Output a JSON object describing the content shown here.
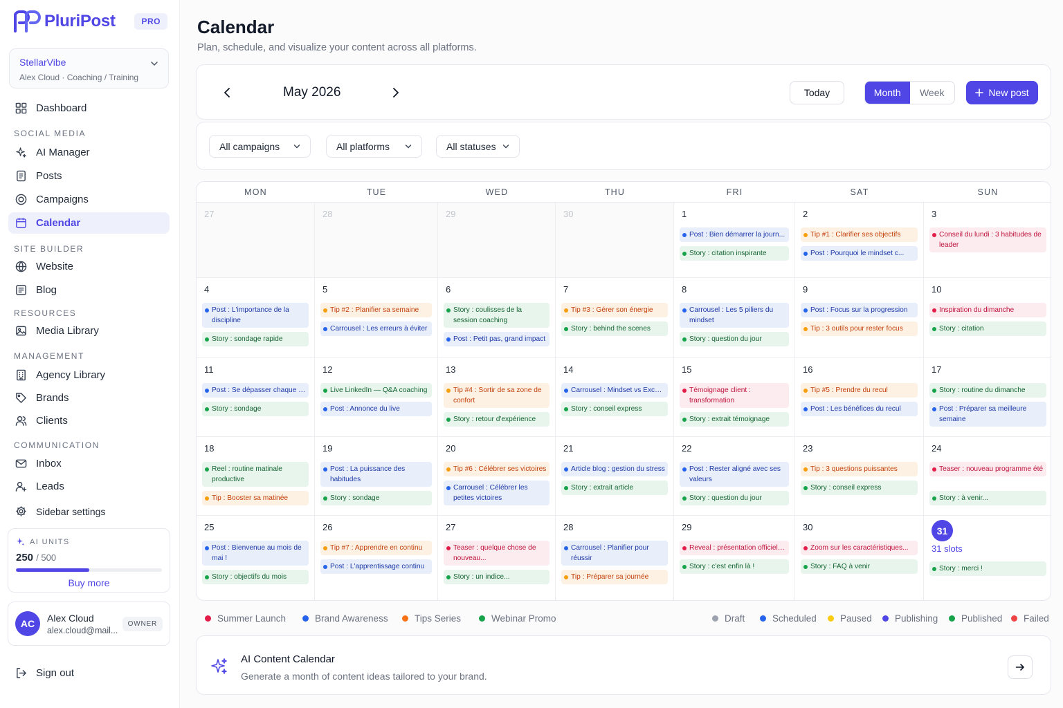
{
  "brand": {
    "name": "PluriPost",
    "badge": "PRO",
    "accent": "#4f46e5"
  },
  "workspace": {
    "name": "StellarVibe",
    "subtitle": "Alex Cloud · Coaching / Training"
  },
  "nav": {
    "dashboard": "Dashboard",
    "social_section": "SOCIAL MEDIA",
    "ai_manager": "AI Manager",
    "posts": "Posts",
    "campaigns": "Campaigns",
    "calendar": "Calendar",
    "site_section": "SITE BUILDER",
    "website": "Website",
    "blog": "Blog",
    "resources_section": "RESOURCES",
    "media_library": "Media Library",
    "management_section": "MANAGEMENT",
    "agency_library": "Agency Library",
    "brands": "Brands",
    "clients": "Clients",
    "communication_section": "COMMUNICATION",
    "inbox": "Inbox",
    "leads": "Leads",
    "sidebar_settings": "Sidebar settings",
    "sign_out": "Sign out"
  },
  "ai_units": {
    "label": "AI UNITS",
    "used": "250",
    "max": "/ 500",
    "fraction": 0.5,
    "buy_more": "Buy more"
  },
  "user": {
    "initials": "AC",
    "name": "Alex Cloud",
    "email": "alex.cloud@mail...",
    "role": "OWNER"
  },
  "header": {
    "title": "Calendar",
    "subtitle": "Plan, schedule, and visualize your content across all platforms."
  },
  "toolbar": {
    "month": "May 2026",
    "today": "Today",
    "view_month": "Month",
    "view_week": "Week",
    "new_post": "New post"
  },
  "filters": {
    "campaigns": "All campaigns",
    "platforms": "All platforms",
    "statuses": "All statuses"
  },
  "weekdays": [
    "MON",
    "TUE",
    "WED",
    "THU",
    "FRI",
    "SAT",
    "SUN"
  ],
  "weeks": [
    [
      {
        "day": "27",
        "muted": true,
        "events": []
      },
      {
        "day": "28",
        "muted": true,
        "events": []
      },
      {
        "day": "29",
        "muted": true,
        "events": []
      },
      {
        "day": "30",
        "muted": true,
        "events": []
      },
      {
        "day": "1",
        "events": [
          {
            "text": "Post : Bien démarrer la journ...",
            "color": "blue"
          },
          {
            "text": "Story : citation inspirante",
            "color": "green"
          }
        ]
      },
      {
        "day": "2",
        "events": [
          {
            "text": "Tip #1 : Clarifier ses objectifs",
            "color": "orange"
          },
          {
            "text": "Post : Pourquoi le mindset c...",
            "color": "blue"
          }
        ]
      },
      {
        "day": "3",
        "events": [
          {
            "text": "Conseil du lundi : 3 habitudes de leader",
            "color": "pink",
            "wrap": true
          }
        ]
      }
    ],
    [
      {
        "day": "4",
        "events": [
          {
            "text": "Post : L'importance de la discipline",
            "color": "blue",
            "wrap": true
          },
          {
            "text": "Story : sondage rapide",
            "color": "green"
          }
        ]
      },
      {
        "day": "5",
        "events": [
          {
            "text": "Tip #2 : Planifier sa semaine",
            "color": "orange"
          },
          {
            "text": "Carrousel : Les erreurs à éviter",
            "color": "blue"
          }
        ]
      },
      {
        "day": "6",
        "events": [
          {
            "text": "Story : coulisses de la session coaching",
            "color": "green",
            "wrap": true
          },
          {
            "text": "Post : Petit pas, grand impact",
            "color": "blue"
          }
        ]
      },
      {
        "day": "7",
        "events": [
          {
            "text": "Tip #3 : Gérer son énergie",
            "color": "orange"
          },
          {
            "text": "Story : behind the scenes",
            "color": "green"
          }
        ]
      },
      {
        "day": "8",
        "events": [
          {
            "text": "Carrousel : Les 5 piliers du mindset",
            "color": "blue",
            "wrap": true
          },
          {
            "text": "Story : question du jour",
            "color": "green"
          }
        ]
      },
      {
        "day": "9",
        "events": [
          {
            "text": "Post : Focus sur la progression",
            "color": "blue"
          },
          {
            "text": "Tip : 3 outils pour rester focus",
            "color": "orange"
          }
        ]
      },
      {
        "day": "10",
        "events": [
          {
            "text": "Inspiration du dimanche",
            "color": "pink"
          },
          {
            "text": "Story : citation",
            "color": "green"
          }
        ]
      }
    ],
    [
      {
        "day": "11",
        "events": [
          {
            "text": "Post : Se dépasser chaque jour",
            "color": "blue"
          },
          {
            "text": "Story : sondage",
            "color": "green"
          }
        ]
      },
      {
        "day": "12",
        "events": [
          {
            "text": "Live LinkedIn — Q&A coaching",
            "color": "green"
          },
          {
            "text": "Post : Annonce du live",
            "color": "blue"
          }
        ]
      },
      {
        "day": "13",
        "events": [
          {
            "text": "Tip #4 : Sortir de sa zone de confort",
            "color": "orange",
            "wrap": true
          },
          {
            "text": "Story : retour d'expérience",
            "color": "green"
          }
        ]
      },
      {
        "day": "14",
        "events": [
          {
            "text": "Carrousel : Mindset vs Excuses",
            "color": "blue"
          },
          {
            "text": "Story : conseil express",
            "color": "green"
          }
        ]
      },
      {
        "day": "15",
        "events": [
          {
            "text": "Témoignage client : transformation",
            "color": "pink",
            "wrap": true
          },
          {
            "text": "Story : extrait témoignage",
            "color": "green"
          }
        ]
      },
      {
        "day": "16",
        "events": [
          {
            "text": "Tip #5 : Prendre du recul",
            "color": "orange"
          },
          {
            "text": "Post : Les bénéfices du recul",
            "color": "blue"
          }
        ]
      },
      {
        "day": "17",
        "events": [
          {
            "text": "Story : routine du dimanche",
            "color": "green"
          },
          {
            "text": "Post : Préparer sa meilleure semaine",
            "color": "blue",
            "wrap": true
          }
        ]
      }
    ],
    [
      {
        "day": "18",
        "events": [
          {
            "text": "Reel : routine matinale productive",
            "color": "green",
            "wrap": true
          },
          {
            "text": "Tip : Booster sa matinée",
            "color": "orange"
          }
        ]
      },
      {
        "day": "19",
        "events": [
          {
            "text": "Post : La puissance des habitudes",
            "color": "blue",
            "wrap": true
          },
          {
            "text": "Story : sondage",
            "color": "green"
          }
        ]
      },
      {
        "day": "20",
        "events": [
          {
            "text": "Tip #6 : Célébrer ses victoires",
            "color": "orange"
          },
          {
            "text": "Carrousel : Célébrer les petites victoires",
            "color": "blue",
            "wrap": true
          }
        ]
      },
      {
        "day": "21",
        "events": [
          {
            "text": "Article blog : gestion du stress",
            "color": "blue"
          },
          {
            "text": "Story : extrait article",
            "color": "green"
          }
        ]
      },
      {
        "day": "22",
        "events": [
          {
            "text": "Post : Rester aligné avec ses valeurs",
            "color": "blue",
            "wrap": true
          },
          {
            "text": "Story : question du jour",
            "color": "green"
          }
        ]
      },
      {
        "day": "23",
        "events": [
          {
            "text": "Tip : 3 questions puissantes",
            "color": "orange"
          },
          {
            "text": "Story : conseil express",
            "color": "green"
          }
        ]
      },
      {
        "day": "24",
        "events": [
          {
            "text": "Teaser : nouveau programme été",
            "color": "pink",
            "wrap": true
          },
          {
            "text": "Story : à venir...",
            "color": "green"
          }
        ]
      }
    ],
    [
      {
        "day": "25",
        "events": [
          {
            "text": "Post : Bienvenue au mois de mai !",
            "color": "blue",
            "wrap": true
          },
          {
            "text": "Story : objectifs du mois",
            "color": "green"
          }
        ]
      },
      {
        "day": "26",
        "events": [
          {
            "text": "Tip #7 : Apprendre en continu",
            "color": "orange"
          },
          {
            "text": "Post : L'apprentissage continu",
            "color": "blue"
          }
        ]
      },
      {
        "day": "27",
        "events": [
          {
            "text": "Teaser : quelque chose de nouveau...",
            "color": "pink",
            "wrap": true
          },
          {
            "text": "Story : un indice...",
            "color": "green"
          }
        ]
      },
      {
        "day": "28",
        "events": [
          {
            "text": "Carrousel : Planifier pour réussir",
            "color": "blue",
            "wrap": true
          },
          {
            "text": "Tip : Préparer sa journée",
            "color": "orange"
          }
        ]
      },
      {
        "day": "29",
        "events": [
          {
            "text": "Reveal : présentation officielle...",
            "color": "pink"
          },
          {
            "text": "Story : c'est enfin là !",
            "color": "green"
          }
        ]
      },
      {
        "day": "30",
        "events": [
          {
            "text": "Zoom sur les caractéristiques...",
            "color": "pink"
          },
          {
            "text": "Story : FAQ à venir",
            "color": "green"
          }
        ]
      },
      {
        "day": "31",
        "today": true,
        "slots": "31 slots",
        "events": [
          {
            "text": "Story : merci !",
            "color": "green"
          }
        ]
      }
    ]
  ],
  "legend_campaigns": [
    {
      "label": "Summer Launch",
      "color": "#e11d48"
    },
    {
      "label": "Brand Awareness",
      "color": "#2563eb"
    },
    {
      "label": "Tips Series",
      "color": "#f97316"
    },
    {
      "label": "Webinar Promo",
      "color": "#16a34a"
    }
  ],
  "legend_statuses": [
    {
      "label": "Draft",
      "color": "#9ca3af"
    },
    {
      "label": "Scheduled",
      "color": "#2563eb"
    },
    {
      "label": "Paused",
      "color": "#facc15"
    },
    {
      "label": "Publishing",
      "color": "#4f46e5"
    },
    {
      "label": "Published",
      "color": "#16a34a"
    },
    {
      "label": "Failed",
      "color": "#ef4444"
    }
  ],
  "ai_calendar": {
    "title": "AI Content Calendar",
    "subtitle": "Generate a month of content ideas tailored to your brand."
  }
}
